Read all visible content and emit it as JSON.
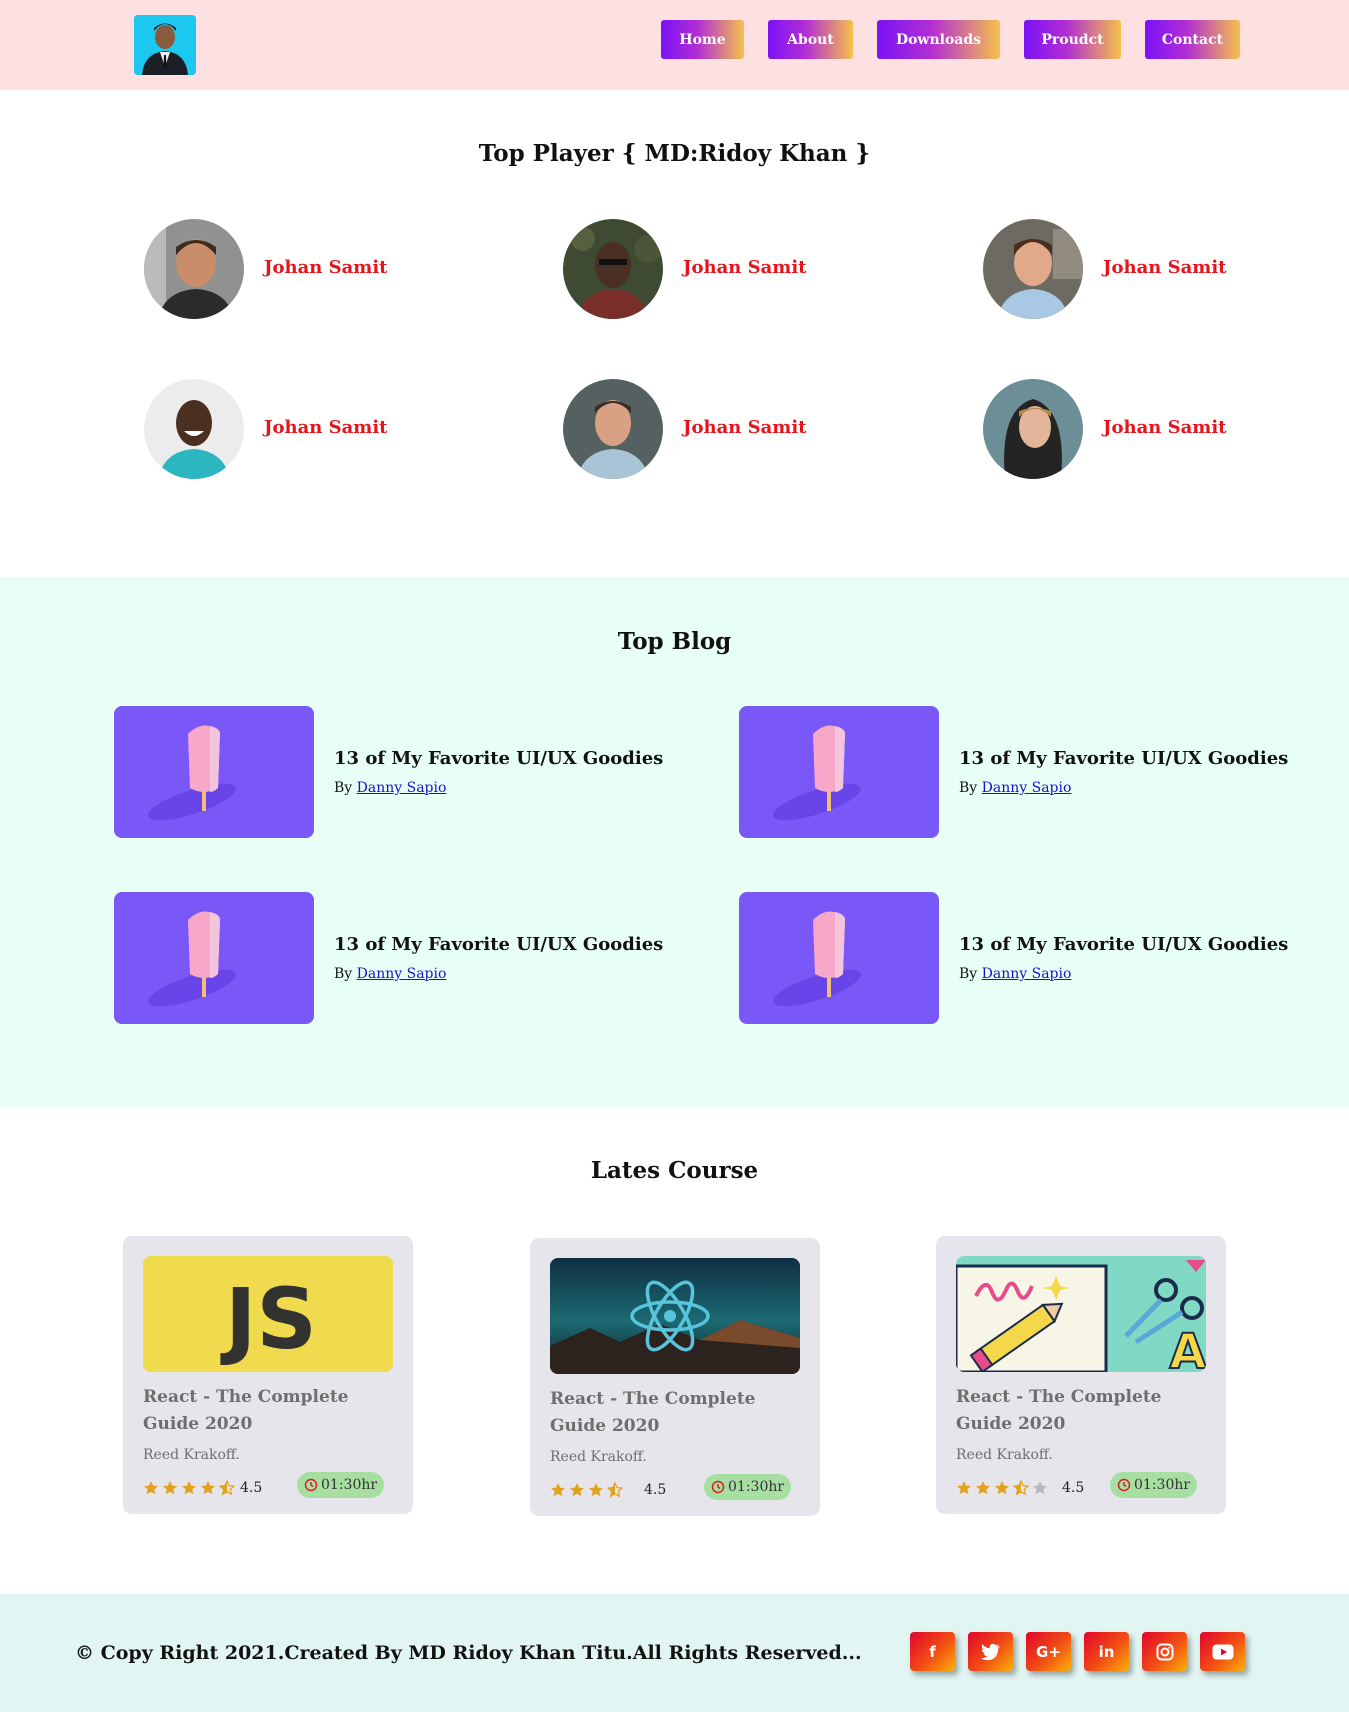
{
  "nav": {
    "items": [
      {
        "label": "Home"
      },
      {
        "label": "About"
      },
      {
        "label": "Downloads"
      },
      {
        "label": "Proudct"
      },
      {
        "label": "Contact"
      }
    ]
  },
  "players": {
    "title": "Top Player { MD:Ridoy Khan }",
    "items": [
      {
        "name": "Johan Samit"
      },
      {
        "name": "Johan Samit"
      },
      {
        "name": "Johan Samit"
      },
      {
        "name": "Johan Samit"
      },
      {
        "name": "Johan Samit"
      },
      {
        "name": "Johan Samit"
      }
    ]
  },
  "blog": {
    "title": "Top Blog",
    "by_label": "By",
    "items": [
      {
        "title": "13 of My Favorite UI/UX Goodies",
        "author": "Danny Sapio"
      },
      {
        "title": "13 of My Favorite UI/UX Goodies",
        "author": "Danny Sapio"
      },
      {
        "title": "13 of My Favorite UI/UX Goodies",
        "author": "Danny Sapio"
      },
      {
        "title": "13 of My Favorite UI/UX Goodies",
        "author": "Danny Sapio"
      }
    ]
  },
  "courses": {
    "title": "Lates Course",
    "items": [
      {
        "image_text": "JS",
        "title": "React - The Complete Guide 2020",
        "author": "Reed Krakoff.",
        "rating": "4.5",
        "stars": 4.5,
        "duration": "01:30hr"
      },
      {
        "image_text": "",
        "title": "React - The Complete Guide 2020",
        "author": "Reed Krakoff.",
        "rating": "4.5",
        "stars": 3.5,
        "duration": "01:30hr"
      },
      {
        "image_text": "A",
        "title": "React - The Complete Guide 2020",
        "author": "Reed Krakoff.",
        "rating": "4.5",
        "stars": 3.5,
        "duration": "01:30hr"
      }
    ]
  },
  "footer": {
    "copyright": "© Copy Right 2021.Created By MD Ridoy Khan Titu.All Rights Reserved...",
    "social": [
      {
        "icon": "facebook-icon",
        "glyph": "f"
      },
      {
        "icon": "twitter-icon",
        "glyph": ""
      },
      {
        "icon": "google-plus-icon",
        "glyph": "G+"
      },
      {
        "icon": "linkedin-icon",
        "glyph": "in"
      },
      {
        "icon": "instagram-icon",
        "glyph": ""
      },
      {
        "icon": "youtube-icon",
        "glyph": ""
      }
    ]
  },
  "colors": {
    "nav_bg": "#fde1e2",
    "player_name": "#e8141c",
    "blog_bg": "#e8fff7",
    "blog_card": "#7958f7",
    "course_card": "#e6e5eb",
    "duration_badge": "#a7dfa3",
    "footer_bg": "#e1f5f3",
    "star": "#e2a11e"
  }
}
